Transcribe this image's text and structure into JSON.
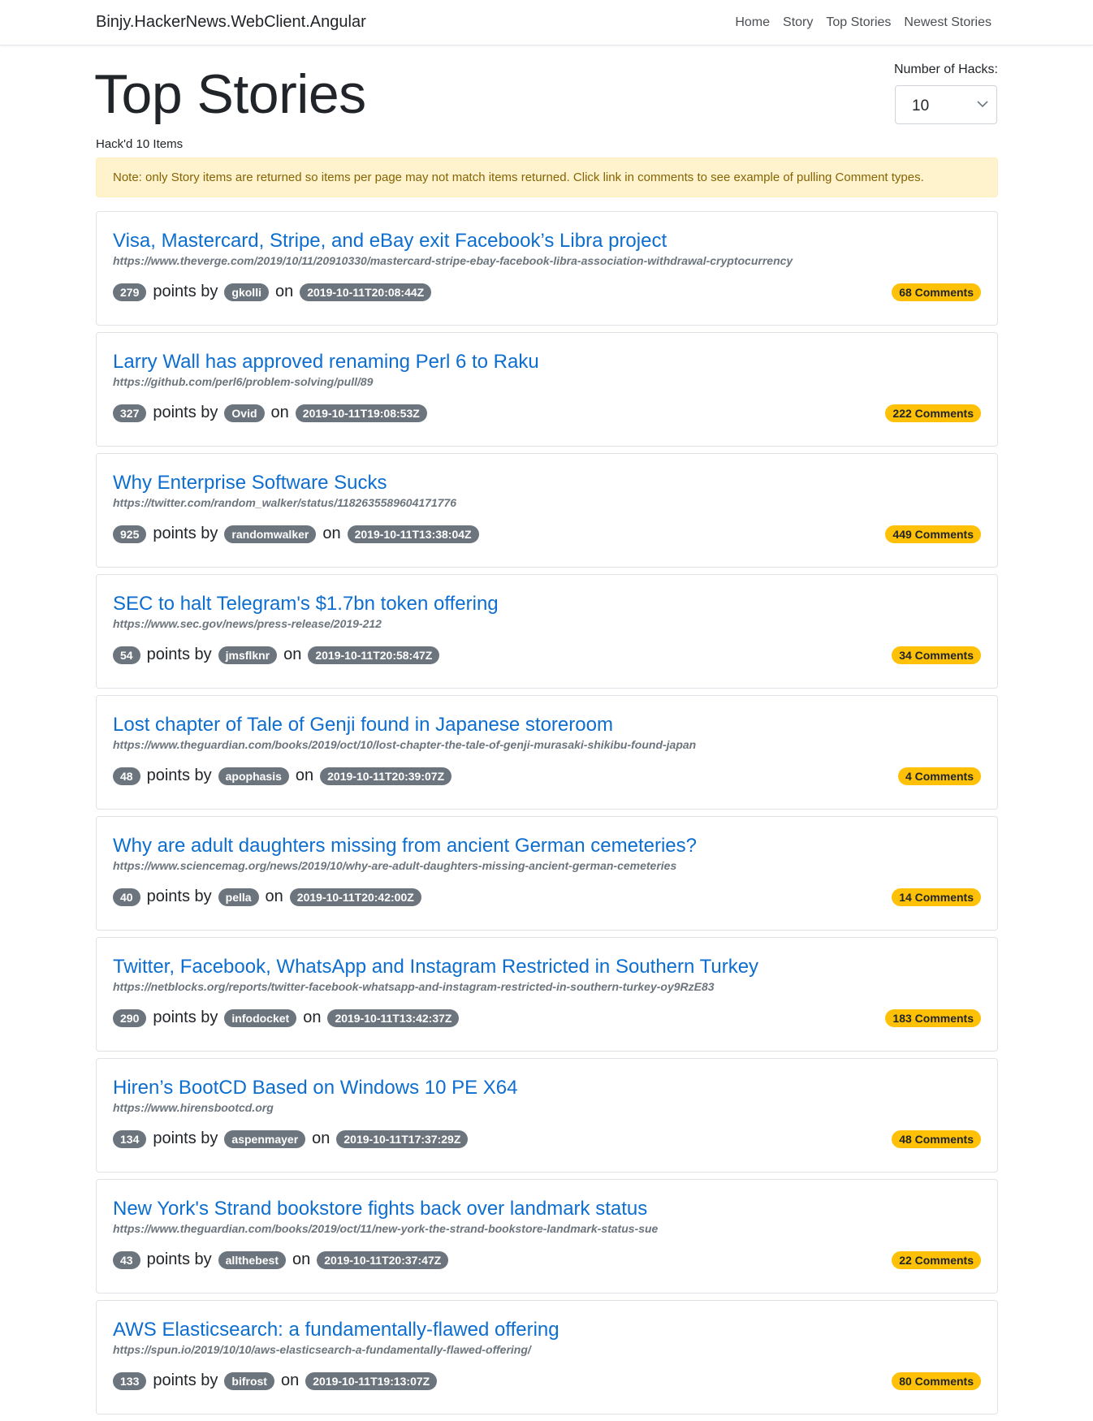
{
  "navbar": {
    "brand": "Binjy.HackerNews.WebClient.Angular",
    "links": [
      {
        "label": "Home"
      },
      {
        "label": "Story"
      },
      {
        "label": "Top Stories"
      },
      {
        "label": "Newest Stories"
      }
    ]
  },
  "header": {
    "title": "Top Stories",
    "hack_count": "Hack'd 10 Items",
    "hacks_label": "Number of Hacks:",
    "hacks_selected": "10",
    "hacks_chevron_icon": "chevron-down-icon"
  },
  "alert": {
    "text": "Note: only Story items are returned so items per page may not match items returned. Click link in comments to see example of pulling Comment types."
  },
  "labels": {
    "points_by": "points by",
    "on": "on"
  },
  "colors": {
    "link": "#0d6ecf",
    "badge_secondary": "#6c757d",
    "badge_warning": "#ffc107",
    "alert_bg": "#fff3cd",
    "alert_text": "#856404"
  },
  "stories": [
    {
      "title": "Visa, Mastercard, Stripe, and eBay exit Facebook’s Libra project",
      "url": "https://www.theverge.com/2019/10/11/20910330/mastercard-stripe-ebay-facebook-libra-association-withdrawal-cryptocurrency",
      "points": "279",
      "author": "gkolli",
      "time": "2019-10-11T20:08:44Z",
      "comments": "68 Comments"
    },
    {
      "title": "Larry Wall has approved renaming Perl 6 to Raku",
      "url": "https://github.com/perl6/problem-solving/pull/89",
      "points": "327",
      "author": "Ovid",
      "time": "2019-10-11T19:08:53Z",
      "comments": "222 Comments"
    },
    {
      "title": "Why Enterprise Software Sucks",
      "url": "https://twitter.com/random_walker/status/1182635589604171776",
      "points": "925",
      "author": "randomwalker",
      "time": "2019-10-11T13:38:04Z",
      "comments": "449 Comments"
    },
    {
      "title": "SEC to halt Telegram's $1.7bn token offering",
      "url": "https://www.sec.gov/news/press-release/2019-212",
      "points": "54",
      "author": "jmsflknr",
      "time": "2019-10-11T20:58:47Z",
      "comments": "34 Comments"
    },
    {
      "title": "Lost chapter of Tale of Genji found in Japanese storeroom",
      "url": "https://www.theguardian.com/books/2019/oct/10/lost-chapter-the-tale-of-genji-murasaki-shikibu-found-japan",
      "points": "48",
      "author": "apophasis",
      "time": "2019-10-11T20:39:07Z",
      "comments": "4 Comments"
    },
    {
      "title": "Why are adult daughters missing from ancient German cemeteries?",
      "url": "https://www.sciencemag.org/news/2019/10/why-are-adult-daughters-missing-ancient-german-cemeteries",
      "points": "40",
      "author": "pella",
      "time": "2019-10-11T20:42:00Z",
      "comments": "14 Comments"
    },
    {
      "title": "Twitter, Facebook, WhatsApp and Instagram Restricted in Southern Turkey",
      "url": "https://netblocks.org/reports/twitter-facebook-whatsapp-and-instagram-restricted-in-southern-turkey-oy9RzE83",
      "points": "290",
      "author": "infodocket",
      "time": "2019-10-11T13:42:37Z",
      "comments": "183 Comments"
    },
    {
      "title": "Hiren’s BootCD Based on Windows 10 PE X64",
      "url": "https://www.hirensbootcd.org",
      "points": "134",
      "author": "aspenmayer",
      "time": "2019-10-11T17:37:29Z",
      "comments": "48 Comments"
    },
    {
      "title": "New York's Strand bookstore fights back over landmark status",
      "url": "https://www.theguardian.com/books/2019/oct/11/new-york-the-strand-bookstore-landmark-status-sue",
      "points": "43",
      "author": "allthebest",
      "time": "2019-10-11T20:37:47Z",
      "comments": "22 Comments"
    },
    {
      "title": "AWS Elasticsearch: a fundamentally-flawed offering",
      "url": "https://spun.io/2019/10/10/aws-elasticsearch-a-fundamentally-flawed-offering/",
      "points": "133",
      "author": "bifrost",
      "time": "2019-10-11T19:13:07Z",
      "comments": "80 Comments"
    }
  ]
}
